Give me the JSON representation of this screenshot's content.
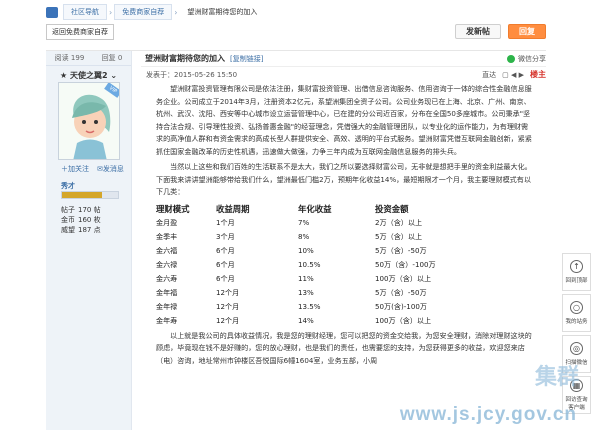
{
  "breadcrumb": {
    "items": [
      "社区导航",
      "免费商家自荐",
      "望洲财富期待您的加入"
    ]
  },
  "topbar": {
    "back_label": "返回免费商家自荐",
    "new_post": "发新帖",
    "reply": "回复"
  },
  "sidebar": {
    "views_label": "阅读",
    "views": "199",
    "replies_label": "回复",
    "replies": "0",
    "username": "天使之翼2",
    "follow": "加关注",
    "message": "发消息",
    "level": "秀才",
    "level_progress": 0.72,
    "stats": [
      {
        "label": "帖子",
        "value": "170 帖"
      },
      {
        "label": "金币",
        "value": "160 枚"
      },
      {
        "label": "威望",
        "value": "187 点"
      }
    ]
  },
  "post": {
    "title": "望洲财富期待您的加入",
    "copy_link": "[复制链接]",
    "wechat": "微信分享",
    "time": "发表于：2015-05-26 15:50",
    "only_author": "直达",
    "floor": "楼主"
  },
  "chart_data": {
    "type": "table",
    "title": "",
    "columns": [
      "理财模式",
      "收益周期",
      "年化收益",
      "投资金额"
    ],
    "rows": [
      [
        "金月盈",
        "1个月",
        "7%",
        "2万（含）以上"
      ],
      [
        "金季丰",
        "3个月",
        "8%",
        "5万（含）以上"
      ],
      [
        "金六福",
        "6个月",
        "10%",
        "5万（含）-50万"
      ],
      [
        "金六禄",
        "6个月",
        "10.5%",
        "50万（含）-100万"
      ],
      [
        "金六寿",
        "6个月",
        "11%",
        "100万（含）以上"
      ],
      [
        "金年福",
        "12个月",
        "13%",
        "5万（含）-50万"
      ],
      [
        "金年禄",
        "12个月",
        "13.5%",
        "50万(含)-100万"
      ],
      [
        "金年寿",
        "12个月",
        "14%",
        "100万（含）以上"
      ]
    ]
  },
  "content": {
    "intro": "望洲财富投资管理有限公司是依法注册，集财富投资管理、出借信息咨询服务、信用咨询于一体的综合性金融信息服务企业。公司成立于2014年3月，注册资本2亿元，系望洲集团全资子公司。公司业务现已在上海、北京、广州、南京、杭州、武汉、沈阳、西安等中心城市设立运营管理中心，已在建的分公司近百家，分布在全国50多座城市。公司秉承\"坚持合法合规、引导理性投资、弘扬普惠金融\"的经营理念，凭借强大的金融管理团队，以专业化的运作能力，为有理财需求的高净值人群和有资金需求的高成长型人群提供安全、高效、透明的平台式服务。望洲财富凭借互联网金融创新，紧紧抓住国家金融改革的历史性机遇，迅速做大做强，力争三年内成为互联网金融信息服务的排头兵。",
    "mid": "当然以上这些和我们百姓的生活联系不是太大，我们之所以要选择财富公司，无非就是想把手里的资金利益最大化。下面我来讲讲望洲能够带给我们什么，望洲最低门槛2万，预期年化收益14%，最短期限才一个月，我主要理财模式有以下几类：",
    "summary": "以上就是我公司的具体收益情况，我是您的理财经理，您可以把您的资金交给我，为您安全理财，消除对理财这块的顾虑，毕竟现在钱不是好赚的，您的放心理财，也是我们的责任，也需要您的支持，为您获得更多的收益，欢迎您来店（电）咨询，地址常州市钟楼区吾悦国际6幢1604室，业务五部，小周"
  },
  "floatbar": [
    {
      "icon": "↑",
      "label": "回到顶部"
    },
    {
      "icon": "○",
      "label": "我的站务"
    },
    {
      "icon": "◎",
      "label": "扫描微信"
    },
    {
      "icon": "▦",
      "label": "回访查询 客户端"
    }
  ],
  "watermark": {
    "cn": "集群",
    "url": "www.js.jcy.gov.cn"
  }
}
